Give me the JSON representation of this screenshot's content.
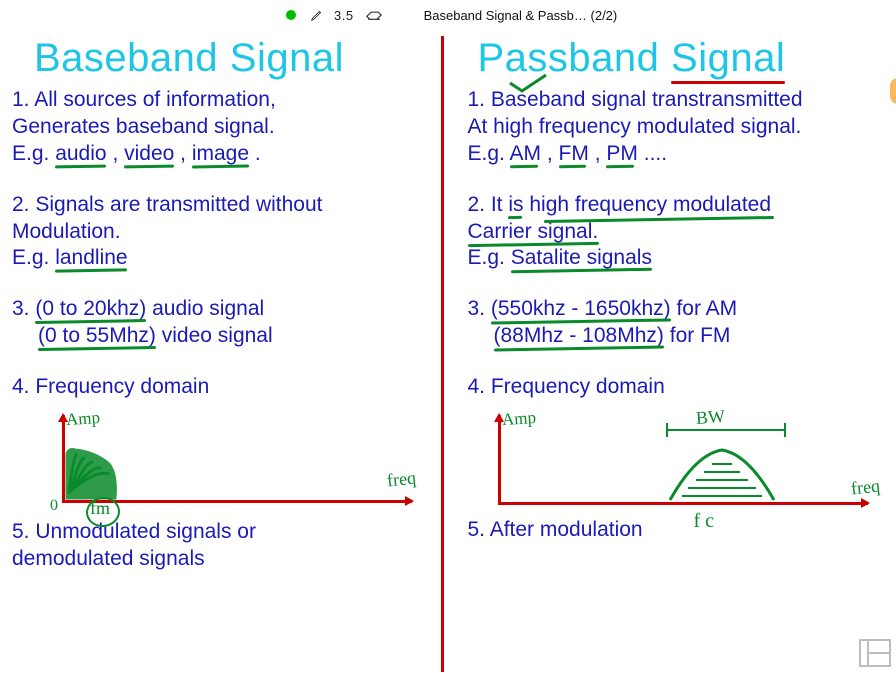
{
  "toolbar": {
    "stroke_size": "3.5",
    "doc_title": "Baseband Signal & Passb… (2/2)"
  },
  "left": {
    "title": "Baseband Signal",
    "p1_a": "1. All sources of information,",
    "p1_b": "Generates baseband signal.",
    "p1_c_pre": "E.g. ",
    "p1_audio": "audio",
    "p1_sep1": ", ",
    "p1_video": "video",
    "p1_sep2": ", ",
    "p1_image": "image",
    "p1_end": ".",
    "p2_a": "2. Signals are transmitted without",
    "p2_b": "Modulation.",
    "p2_c_pre": "E.g. ",
    "p2_landline": "landline",
    "p3_a_pre": "3. ",
    "p3_a_range": "(0 to 20khz)",
    "p3_a_post": " audio signal",
    "p3_b_range": "(0 to 55Mhz)",
    "p3_b_post": " video signal",
    "p4": "4. Frequency  domain",
    "graph": {
      "amp": "Amp",
      "zero": "0",
      "fm": "fm",
      "freq": "freq"
    },
    "p5_a": "5.  Unmodulated signals or",
    "p5_b": " demodulated signals"
  },
  "right": {
    "title_a": "Passband ",
    "title_b": "Signal",
    "p1_a": "1. Baseband signal transtransmitted",
    "p1_b": "At high frequency modulated signal.",
    "p1_c_pre": "E.g. ",
    "p1_am": "AM",
    "p1_sep1": ", ",
    "p1_fm": "FM",
    "p1_sep2": ", ",
    "p1_pm": "PM",
    "p1_end": " ....",
    "p2_a_pre": "2. It ",
    "p2_a_is": "is",
    "p2_a_post": " high frequency modulated",
    "p2_b": "Carrier signal.",
    "p2_c_pre": "E.g. ",
    "p2_sat": "Satalite signals",
    "p3_a_pre": "3. ",
    "p3_a_range": "(550khz - 1650khz)",
    "p3_a_post": " for AM",
    "p3_b_range": "(88Mhz - 108Mhz)",
    "p3_b_post": " for FM",
    "p4": "4. Frequency domain",
    "graph": {
      "amp": "Amp",
      "bw": "BW",
      "freq": "freq",
      "fc": "f c"
    },
    "p5": "5. After modulation"
  }
}
